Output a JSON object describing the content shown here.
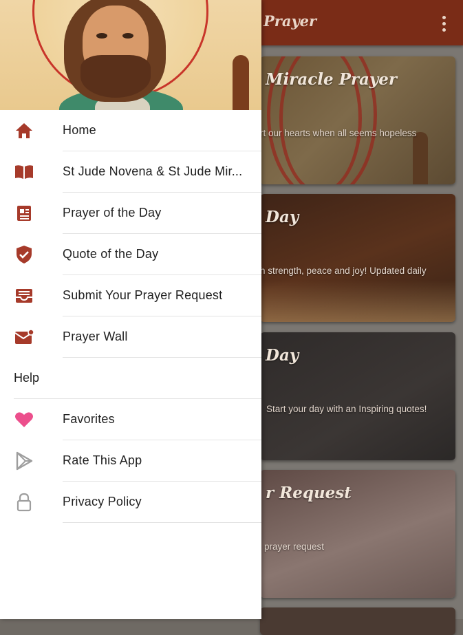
{
  "appbar": {
    "title": "Prayer",
    "overflow_icon": "more-vert-icon",
    "color": "#7a2c17"
  },
  "cards": [
    {
      "title": "Miracle Prayer",
      "subtitle": "rt our hearts when all seems hopeless"
    },
    {
      "title": "Day",
      "subtitle": "h strength, peace and joy! Updated daily"
    },
    {
      "title": "Day",
      "subtitle": "Start your day with an Inspiring quotes!"
    },
    {
      "title": "r Request",
      "subtitle": "prayer request"
    }
  ],
  "drawer": {
    "header_image": "st-jude-icon-painting",
    "accent_color": "#a63a2a",
    "items": [
      {
        "label": "Home",
        "icon": "home-icon"
      },
      {
        "label": "St Jude Novena & St Jude Mir...",
        "icon": "book-icon"
      },
      {
        "label": "Prayer of the Day",
        "icon": "article-icon"
      },
      {
        "label": "Quote of the Day",
        "icon": "shield-check-icon"
      },
      {
        "label": "Submit Your Prayer Request",
        "icon": "inbox-icon"
      },
      {
        "label": "Prayer Wall",
        "icon": "mail-notification-icon"
      }
    ],
    "section_label": "Help",
    "help_items": [
      {
        "label": "Favorites",
        "icon": "heart-icon",
        "color": "#ec4f8c"
      },
      {
        "label": "Rate This App",
        "icon": "play-store-icon"
      },
      {
        "label": "Privacy Policy",
        "icon": "lock-icon"
      }
    ]
  }
}
